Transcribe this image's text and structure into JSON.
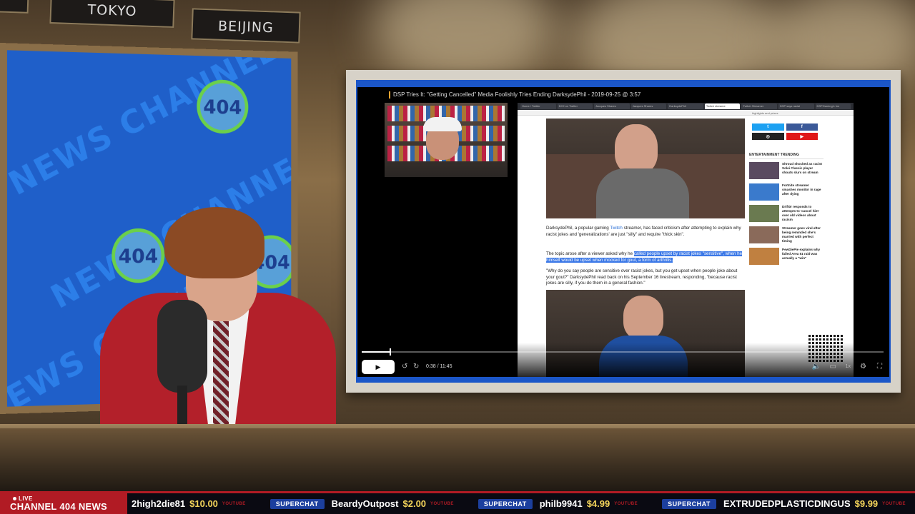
{
  "signs": {
    "tokyo": "TOKYO",
    "beijing": "BEIJING"
  },
  "backdrop": {
    "watermark_text": "NEWS CHANNEL",
    "logo_text": "404"
  },
  "video": {
    "title": "DSP Tries It: \"Getting Cancelled\" Media Foolishly Tries Ending DarksydePhil - 2019-09-25 @ 3:57",
    "time": "0:38 / 11:45",
    "progress_fraction": 0.054,
    "speed": "1x"
  },
  "browser": {
    "tabs": [
      "Home / Twitter",
      "DC2 on Twitter",
      "Jacques Shares",
      "Jacques Shares",
      "DarksydePhil",
      "Twitch streame",
      "Twitch Streamer",
      "DSP says racial",
      "DSPGaming's Ins"
    ],
    "active_tab_index": 5,
    "article_intro": [
      {
        "t": "DarksydePhil, a popular gaming ",
        "c": ""
      },
      {
        "t": "Twitch",
        "c": "link"
      },
      {
        "t": " streamer, has faced criticism after attempting to explain why racist jokes and 'generalizations' are just \"silly\" and require \"thick skin\".",
        "c": ""
      }
    ],
    "article_p2": [
      {
        "t": "The topic arose after a viewer asked why he ",
        "c": ""
      },
      {
        "t": "called people upset by racist jokes \"sensitive\", when he himself would be upset when mocked for gout, a form of arthritis.",
        "c": "hl"
      }
    ],
    "article_p3": "\"Why do you say people are sensitive over racist jokes, but you get upset when people joke about your gout?\" DarksydePhil read back on his September 16 livestream, responding, \"because racist jokes are silly, if you do them in a general fashion.\"",
    "sidebar_top_text": "highlights and prizes",
    "trending_heading": "ENTERTAINMENT TRENDING",
    "trending": [
      "Shroud shocked as racist Solei Classic player shouts slurs on stream",
      "Fortnite streamer smashes monitor in rage after dying",
      "Drift0r responds to attempts to 'cancel him' over old videos about racism",
      "Streamer goes viral after being reminded she's married with perfect timing",
      "PewDiePie explains why failed Area 51 raid was actually a \"win\""
    ]
  },
  "ticker": {
    "live_label": "LIVE",
    "brand": "CHANNEL 404 NEWS",
    "items": [
      {
        "tag": "",
        "name": "2high2die81",
        "amount": "$10.00",
        "source": "YOUTUBE"
      },
      {
        "tag": "SUPERCHAT",
        "name": "BeardyOutpost",
        "amount": "$2.00",
        "source": "YOUTUBE"
      },
      {
        "tag": "SUPERCHAT",
        "name": "philb9941",
        "amount": "$4.99",
        "source": "YOUTUBE"
      },
      {
        "tag": "SUPERCHAT",
        "name": "EXTRUDEDPLASTICDINGUS",
        "amount": "$9.99",
        "source": "YOUTUBE"
      }
    ]
  },
  "colors": {
    "brand_red": "#b11b24",
    "superchat_blue": "#1c3f9e",
    "amount_yellow": "#f3d35a",
    "screen_blue": "#1b56c8"
  }
}
